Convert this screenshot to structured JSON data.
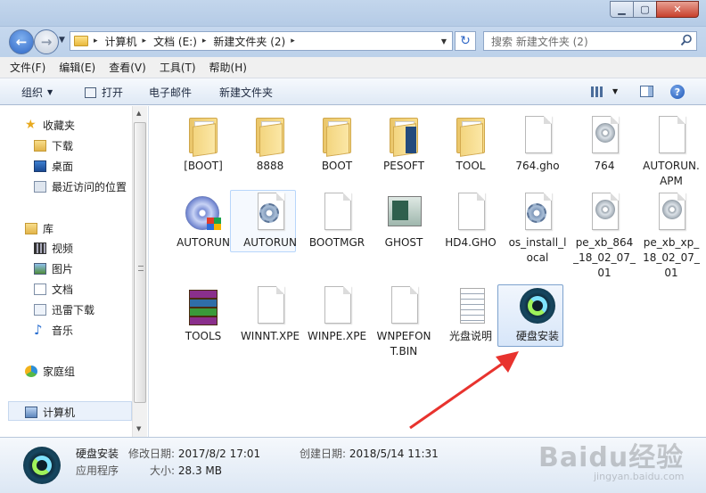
{
  "window": {
    "minimize_glyph": "▁",
    "maximize_glyph": "▢",
    "close_glyph": "✕"
  },
  "address": {
    "crumbs": [
      "计算机",
      "文档 (E:)",
      "新建文件夹 (2)"
    ],
    "separator": "▸",
    "search_placeholder": "搜索 新建文件夹 (2)"
  },
  "menubar": {
    "items": [
      "文件(F)",
      "编辑(E)",
      "查看(V)",
      "工具(T)",
      "帮助(H)"
    ]
  },
  "toolbar": {
    "organize": "组织",
    "open": "打开",
    "email": "电子邮件",
    "new_folder": "新建文件夹",
    "help": "?"
  },
  "nav": {
    "favorites": "收藏夹",
    "downloads": "下载",
    "desktop": "桌面",
    "recent": "最近访问的位置",
    "libraries": "库",
    "videos": "视频",
    "pictures": "图片",
    "documents": "文档",
    "xunlei": "迅雷下载",
    "music": "音乐",
    "homegroup": "家庭组",
    "computer": "计算机"
  },
  "files": [
    {
      "name": "[BOOT]",
      "icon": "folder-icon"
    },
    {
      "name": "8888",
      "icon": "folder-icon"
    },
    {
      "name": "BOOT",
      "icon": "folder-icon"
    },
    {
      "name": "PESOFT",
      "icon": "folder-icon"
    },
    {
      "name": "TOOL",
      "icon": "folder-icon"
    },
    {
      "name": "764.gho",
      "icon": "file-icon"
    },
    {
      "name": "764",
      "icon": "disc-image-icon"
    },
    {
      "name": "AUTORUN.APM",
      "icon": "file-icon"
    },
    {
      "name": "AUTORUN",
      "icon": "autorun-cd-icon"
    },
    {
      "name": "AUTORUN",
      "icon": "settings-file-icon"
    },
    {
      "name": "BOOTMGR",
      "icon": "file-icon"
    },
    {
      "name": "GHOST",
      "icon": "ghost-app-icon"
    },
    {
      "name": "HD4.GHO",
      "icon": "file-icon"
    },
    {
      "name": "os_install_local",
      "icon": "settings-file-icon"
    },
    {
      "name": "pe_xb_864_18_02_07_01",
      "icon": "disc-image-icon"
    },
    {
      "name": "pe_xb_xp_18_02_07_01",
      "icon": "disc-image-icon"
    },
    {
      "name": "TOOLS",
      "icon": "winrar-icon"
    },
    {
      "name": "WINNT.XPE",
      "icon": "file-icon"
    },
    {
      "name": "WINPE.XPE",
      "icon": "file-icon"
    },
    {
      "name": "WNPEFONT.BIN",
      "icon": "file-icon"
    },
    {
      "name": "光盘说明",
      "icon": "text-document-icon"
    },
    {
      "name": "硬盘安装",
      "icon": "sync-app-icon"
    }
  ],
  "details": {
    "name": "硬盘安装",
    "type": "应用程序",
    "modified_label": "修改日期:",
    "modified_value": "2017/8/2 17:01",
    "size_label": "大小:",
    "size_value": "28.3 MB",
    "created_label": "创建日期:",
    "created_value": "2018/5/14 11:31"
  },
  "watermark": {
    "main": "Baidu经验",
    "sub": "jingyan.baidu.com"
  },
  "colors": {
    "annotation_arrow": "#e8332e",
    "selection_border": "#7da2ce"
  }
}
